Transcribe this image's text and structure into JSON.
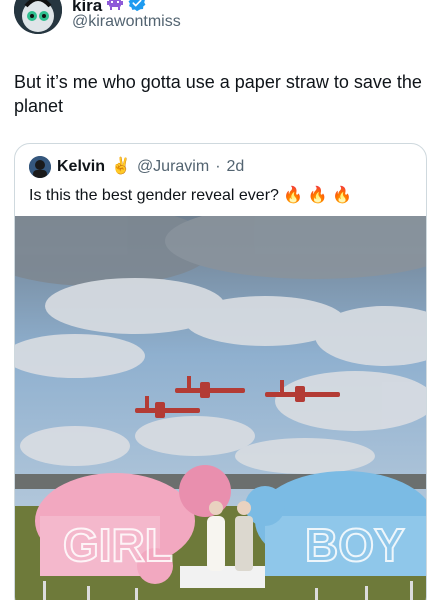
{
  "tweet": {
    "author_name": "kira",
    "author_badge_icon": "alien-monster-icon",
    "verified_icon": "verified-badge-icon",
    "author_handle": "@kirawontmiss",
    "text": "But it’s me who gotta use a paper straw to save the planet"
  },
  "quoted": {
    "author_name": "Kelvin",
    "author_emoji": "✌️",
    "author_handle": "@Juravim",
    "separator": "·",
    "time": "2d",
    "text": "Is this the best gender reveal ever?",
    "flames": "🔥 🔥 🔥",
    "media": {
      "left_letters": "GIRL",
      "right_letters": "BOY",
      "colors": {
        "sky": "#8fb0cf",
        "cloud": "#d9dde2",
        "pink": "#f2a8c0",
        "blue": "#7bbbe4",
        "plane": "#b33b35",
        "grass": "#6e7a3a"
      }
    }
  }
}
